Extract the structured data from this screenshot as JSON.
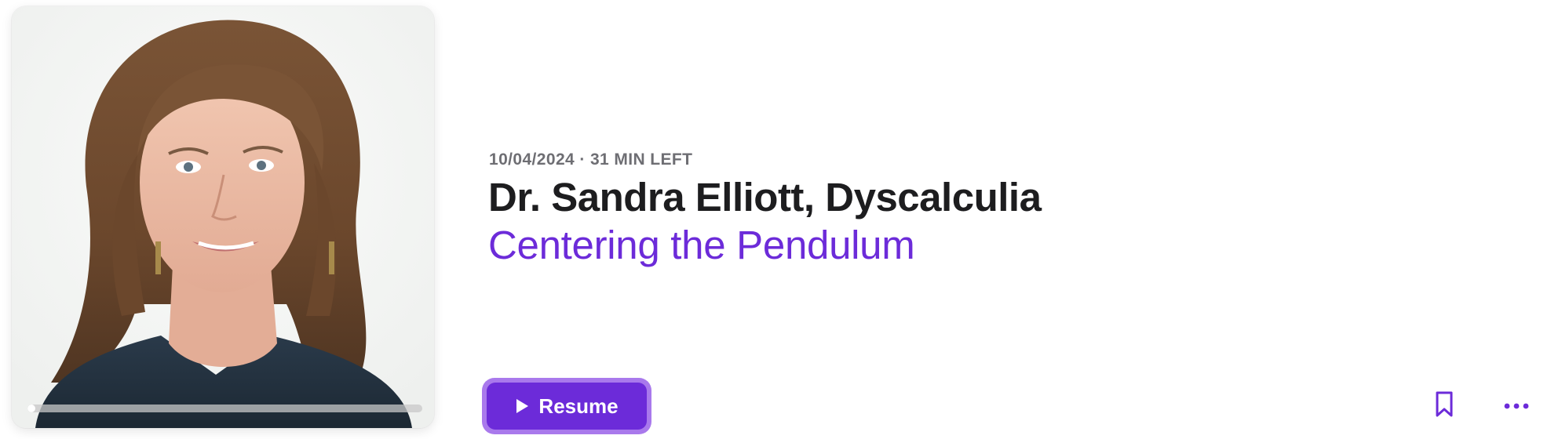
{
  "episode": {
    "meta": "10/04/2024 · 31 MIN LEFT",
    "title": "Dr. Sandra Elliott, Dyscalculia",
    "subtitle": "Centering the Pendulum",
    "progress_fraction": 0.01
  },
  "actions": {
    "resume_label": "Resume",
    "resume_icon": "play-icon",
    "bookmark_icon": "bookmark-icon",
    "more_icon": "more-options-icon"
  },
  "colors": {
    "accent": "#6c2bd9",
    "accent_ring": "#a979ec",
    "title": "#1d1d1f",
    "meta": "#6e6e73"
  }
}
